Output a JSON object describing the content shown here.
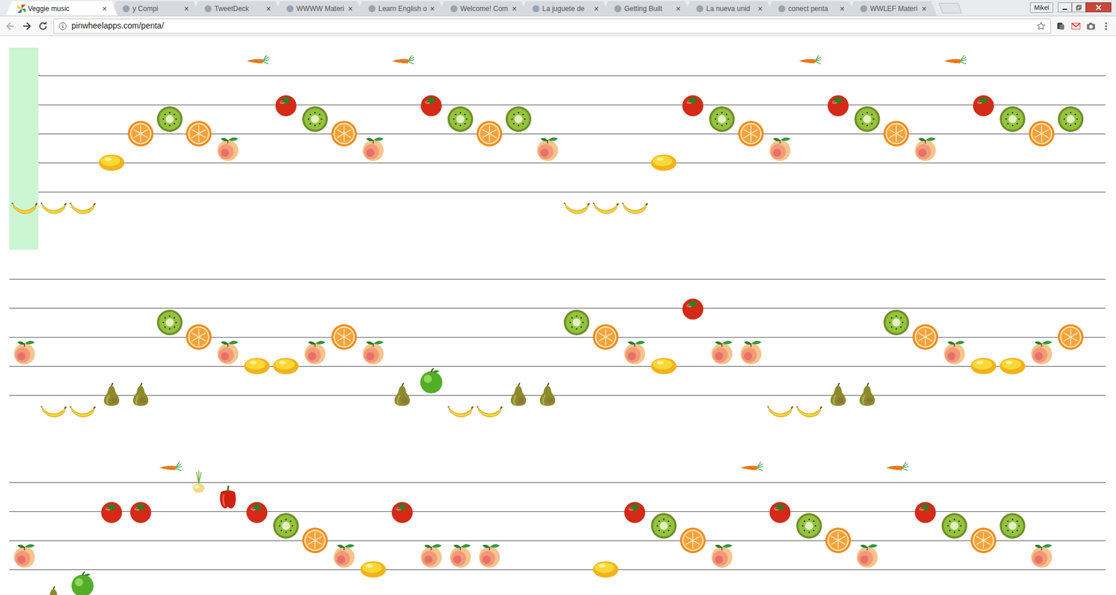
{
  "tabs": [
    {
      "label": "Veggie music",
      "selected": true
    },
    {
      "label": "y Compi",
      "selected": false
    },
    {
      "label": "TweetDeck",
      "selected": false
    },
    {
      "label": "WWWW Materi",
      "selected": false
    },
    {
      "label": "Learn English o",
      "selected": false
    },
    {
      "label": "Welcome! Com",
      "selected": false
    },
    {
      "label": "La juguete de",
      "selected": false
    },
    {
      "label": "Getting Built",
      "selected": false
    },
    {
      "label": "La nueva unid",
      "selected": false
    },
    {
      "label": "conect penta",
      "selected": false
    },
    {
      "label": "WWLEF Materi",
      "selected": false
    }
  ],
  "tab_close": "×",
  "profile": "Mikel",
  "address": {
    "url": "pinwheelapps.com/penta/"
  },
  "playhead": {
    "staff": 0,
    "beat": 0
  },
  "staves": [
    {
      "notes": [
        {
          "beat": 0,
          "fruit": "banana",
          "pitch": -1
        },
        {
          "beat": 1,
          "fruit": "banana",
          "pitch": -1
        },
        {
          "beat": 2,
          "fruit": "banana",
          "pitch": -1
        },
        {
          "beat": 3,
          "fruit": "lemon",
          "pitch": 2
        },
        {
          "beat": 4,
          "fruit": "orange",
          "pitch": 4
        },
        {
          "beat": 5,
          "fruit": "kiwi",
          "pitch": 5
        },
        {
          "beat": 6,
          "fruit": "orange",
          "pitch": 4
        },
        {
          "beat": 7,
          "fruit": "peach",
          "pitch": 3
        },
        {
          "beat": 8,
          "fruit": "carrot",
          "pitch": 9
        },
        {
          "beat": 9,
          "fruit": "tomato",
          "pitch": 6
        },
        {
          "beat": 10,
          "fruit": "kiwi",
          "pitch": 5
        },
        {
          "beat": 11,
          "fruit": "orange",
          "pitch": 4
        },
        {
          "beat": 12,
          "fruit": "peach",
          "pitch": 3
        },
        {
          "beat": 13,
          "fruit": "carrot",
          "pitch": 9
        },
        {
          "beat": 14,
          "fruit": "tomato",
          "pitch": 6
        },
        {
          "beat": 15,
          "fruit": "kiwi",
          "pitch": 5
        },
        {
          "beat": 16,
          "fruit": "orange",
          "pitch": 4
        },
        {
          "beat": 17,
          "fruit": "kiwi",
          "pitch": 5
        },
        {
          "beat": 18,
          "fruit": "peach",
          "pitch": 3
        },
        {
          "beat": 19,
          "fruit": "banana",
          "pitch": -1
        },
        {
          "beat": 20,
          "fruit": "banana",
          "pitch": -1
        },
        {
          "beat": 21,
          "fruit": "banana",
          "pitch": -1
        },
        {
          "beat": 22,
          "fruit": "lemon",
          "pitch": 2
        },
        {
          "beat": 23,
          "fruit": "tomato",
          "pitch": 6
        },
        {
          "beat": 24,
          "fruit": "kiwi",
          "pitch": 5
        },
        {
          "beat": 25,
          "fruit": "orange",
          "pitch": 4
        },
        {
          "beat": 26,
          "fruit": "peach",
          "pitch": 3
        },
        {
          "beat": 27,
          "fruit": "carrot",
          "pitch": 9
        },
        {
          "beat": 28,
          "fruit": "tomato",
          "pitch": 6
        },
        {
          "beat": 29,
          "fruit": "kiwi",
          "pitch": 5
        },
        {
          "beat": 30,
          "fruit": "orange",
          "pitch": 4
        },
        {
          "beat": 31,
          "fruit": "peach",
          "pitch": 3
        },
        {
          "beat": 32,
          "fruit": "carrot",
          "pitch": 9
        },
        {
          "beat": 33,
          "fruit": "tomato",
          "pitch": 6
        },
        {
          "beat": 34,
          "fruit": "kiwi",
          "pitch": 5
        },
        {
          "beat": 35,
          "fruit": "orange",
          "pitch": 4
        },
        {
          "beat": 36,
          "fruit": "kiwi",
          "pitch": 5
        }
      ]
    },
    {
      "notes": [
        {
          "beat": 0,
          "fruit": "peach",
          "pitch": 3
        },
        {
          "beat": 1,
          "fruit": "banana",
          "pitch": -1
        },
        {
          "beat": 2,
          "fruit": "banana",
          "pitch": -1
        },
        {
          "beat": 3,
          "fruit": "pear",
          "pitch": 0
        },
        {
          "beat": 4,
          "fruit": "pear",
          "pitch": 0
        },
        {
          "beat": 5,
          "fruit": "kiwi",
          "pitch": 5
        },
        {
          "beat": 6,
          "fruit": "orange",
          "pitch": 4
        },
        {
          "beat": 7,
          "fruit": "peach",
          "pitch": 3
        },
        {
          "beat": 8,
          "fruit": "lemon",
          "pitch": 2
        },
        {
          "beat": 9,
          "fruit": "lemon",
          "pitch": 2
        },
        {
          "beat": 10,
          "fruit": "peach",
          "pitch": 3
        },
        {
          "beat": 11,
          "fruit": "orange",
          "pitch": 4
        },
        {
          "beat": 12,
          "fruit": "peach",
          "pitch": 3
        },
        {
          "beat": 13,
          "fruit": "pear",
          "pitch": 0
        },
        {
          "beat": 14,
          "fruit": "apple",
          "pitch": 1
        },
        {
          "beat": 15,
          "fruit": "banana",
          "pitch": -1
        },
        {
          "beat": 16,
          "fruit": "banana",
          "pitch": -1
        },
        {
          "beat": 17,
          "fruit": "pear",
          "pitch": 0
        },
        {
          "beat": 18,
          "fruit": "pear",
          "pitch": 0
        },
        {
          "beat": 19,
          "fruit": "kiwi",
          "pitch": 5
        },
        {
          "beat": 20,
          "fruit": "orange",
          "pitch": 4
        },
        {
          "beat": 21,
          "fruit": "peach",
          "pitch": 3
        },
        {
          "beat": 22,
          "fruit": "lemon",
          "pitch": 2
        },
        {
          "beat": 23,
          "fruit": "tomato",
          "pitch": 6
        },
        {
          "beat": 24,
          "fruit": "peach",
          "pitch": 3
        },
        {
          "beat": 25,
          "fruit": "peach",
          "pitch": 3
        },
        {
          "beat": 26,
          "fruit": "banana",
          "pitch": -1
        },
        {
          "beat": 27,
          "fruit": "banana",
          "pitch": -1
        },
        {
          "beat": 28,
          "fruit": "pear",
          "pitch": 0
        },
        {
          "beat": 29,
          "fruit": "pear",
          "pitch": 0
        },
        {
          "beat": 30,
          "fruit": "kiwi",
          "pitch": 5
        },
        {
          "beat": 31,
          "fruit": "orange",
          "pitch": 4
        },
        {
          "beat": 32,
          "fruit": "peach",
          "pitch": 3
        },
        {
          "beat": 33,
          "fruit": "lemon",
          "pitch": 2
        },
        {
          "beat": 34,
          "fruit": "lemon",
          "pitch": 2
        },
        {
          "beat": 35,
          "fruit": "peach",
          "pitch": 3
        },
        {
          "beat": 36,
          "fruit": "orange",
          "pitch": 4
        }
      ]
    },
    {
      "notes": [
        {
          "beat": 0,
          "fruit": "peach",
          "pitch": 3
        },
        {
          "beat": 1,
          "fruit": "pear",
          "pitch": 0
        },
        {
          "beat": 2,
          "fruit": "apple",
          "pitch": 1
        },
        {
          "beat": 3,
          "fruit": "tomato",
          "pitch": 6
        },
        {
          "beat": 4,
          "fruit": "tomato",
          "pitch": 6
        },
        {
          "beat": 5,
          "fruit": "carrot",
          "pitch": 9
        },
        {
          "beat": 6,
          "fruit": "onion",
          "pitch": 8
        },
        {
          "beat": 7,
          "fruit": "pepper",
          "pitch": 7
        },
        {
          "beat": 8,
          "fruit": "tomato",
          "pitch": 6
        },
        {
          "beat": 9,
          "fruit": "kiwi",
          "pitch": 5
        },
        {
          "beat": 10,
          "fruit": "orange",
          "pitch": 4
        },
        {
          "beat": 11,
          "fruit": "peach",
          "pitch": 3
        },
        {
          "beat": 12,
          "fruit": "lemon",
          "pitch": 2
        },
        {
          "beat": 13,
          "fruit": "tomato",
          "pitch": 6
        },
        {
          "beat": 14,
          "fruit": "peach",
          "pitch": 3
        },
        {
          "beat": 15,
          "fruit": "peach",
          "pitch": 3
        },
        {
          "beat": 16,
          "fruit": "peach",
          "pitch": 3
        },
        {
          "beat": 20,
          "fruit": "lemon",
          "pitch": 2
        },
        {
          "beat": 21,
          "fruit": "tomato",
          "pitch": 6
        },
        {
          "beat": 22,
          "fruit": "kiwi",
          "pitch": 5
        },
        {
          "beat": 23,
          "fruit": "orange",
          "pitch": 4
        },
        {
          "beat": 24,
          "fruit": "peach",
          "pitch": 3
        },
        {
          "beat": 25,
          "fruit": "carrot",
          "pitch": 9
        },
        {
          "beat": 26,
          "fruit": "tomato",
          "pitch": 6
        },
        {
          "beat": 27,
          "fruit": "kiwi",
          "pitch": 5
        },
        {
          "beat": 28,
          "fruit": "orange",
          "pitch": 4
        },
        {
          "beat": 29,
          "fruit": "peach",
          "pitch": 3
        },
        {
          "beat": 30,
          "fruit": "carrot",
          "pitch": 9
        },
        {
          "beat": 31,
          "fruit": "tomato",
          "pitch": 6
        },
        {
          "beat": 32,
          "fruit": "kiwi",
          "pitch": 5
        },
        {
          "beat": 33,
          "fruit": "orange",
          "pitch": 4
        },
        {
          "beat": 34,
          "fruit": "kiwi",
          "pitch": 5
        },
        {
          "beat": 35,
          "fruit": "peach",
          "pitch": 3
        }
      ]
    }
  ]
}
